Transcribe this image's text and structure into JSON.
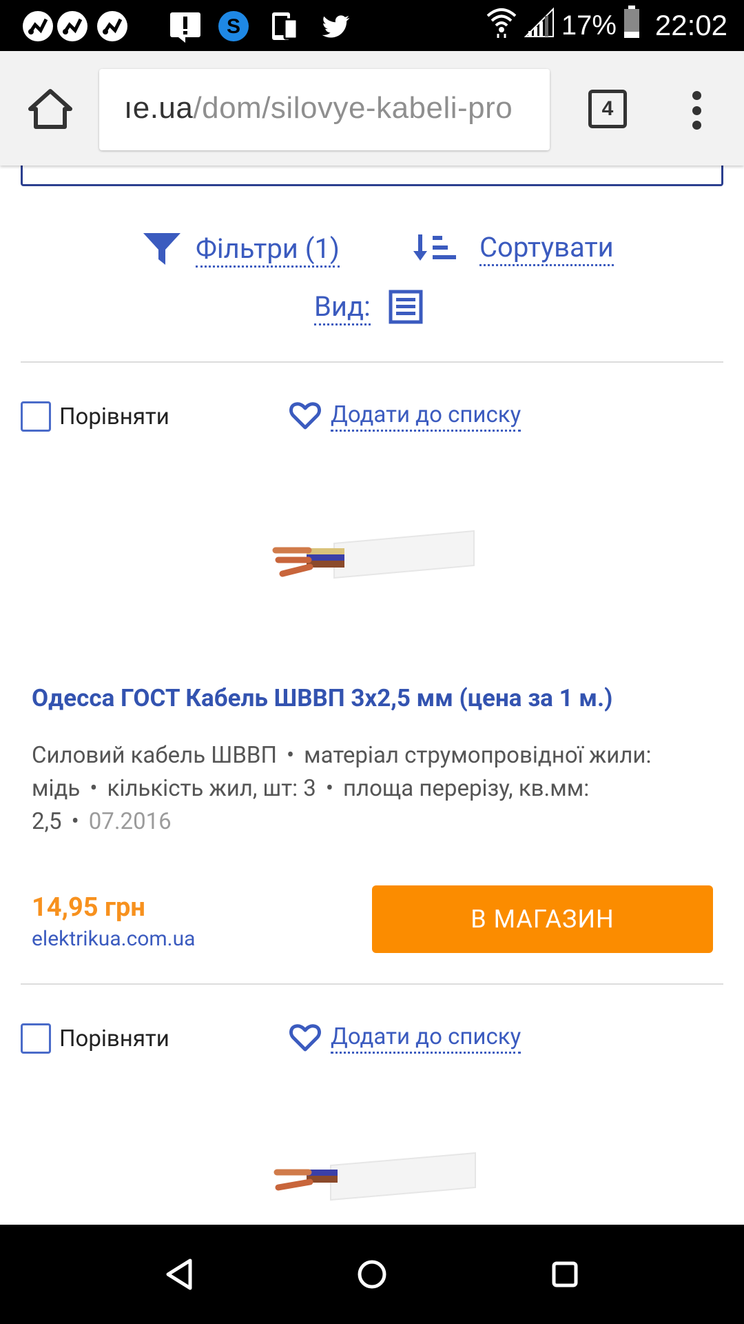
{
  "status_bar": {
    "notification_icons": [
      "app-icon",
      "app-icon",
      "app-icon",
      "alert-icon",
      "skype-icon",
      "phone-tablet-icon",
      "twitter-icon"
    ],
    "battery": "17%",
    "time": "22:02"
  },
  "browser": {
    "url_domain": "ıe.ua",
    "url_path": "/dom/silovye-kabeli-pro",
    "tab_count": "4"
  },
  "controls": {
    "filters_label": "Фільтри (1)",
    "sort_label": "Сортувати",
    "view_label": "Вид:"
  },
  "products": [
    {
      "compare_label": "Порівняти",
      "wishlist_label": "Додати до списку",
      "title": "Одесса ГОСТ Кабель ШВВП 3х2,5 мм (цена за 1 м.)",
      "specs": [
        "Силовий кабель ШВВП",
        "матеріал струмопровідної жили: мідь",
        "кількість жил, шт: 3",
        "площа перерізу, кв.мм: 2,5"
      ],
      "date": "07.2016",
      "price": "14,95 грн",
      "shop": "elektrikua.com.ua",
      "button_label": "В МАГАЗИН"
    },
    {
      "compare_label": "Порівняти",
      "wishlist_label": "Додати до списку"
    }
  ],
  "colors": {
    "link": "#3b5bbf",
    "title": "#3353b0",
    "price": "#f7911e",
    "button": "#fb8c00"
  }
}
